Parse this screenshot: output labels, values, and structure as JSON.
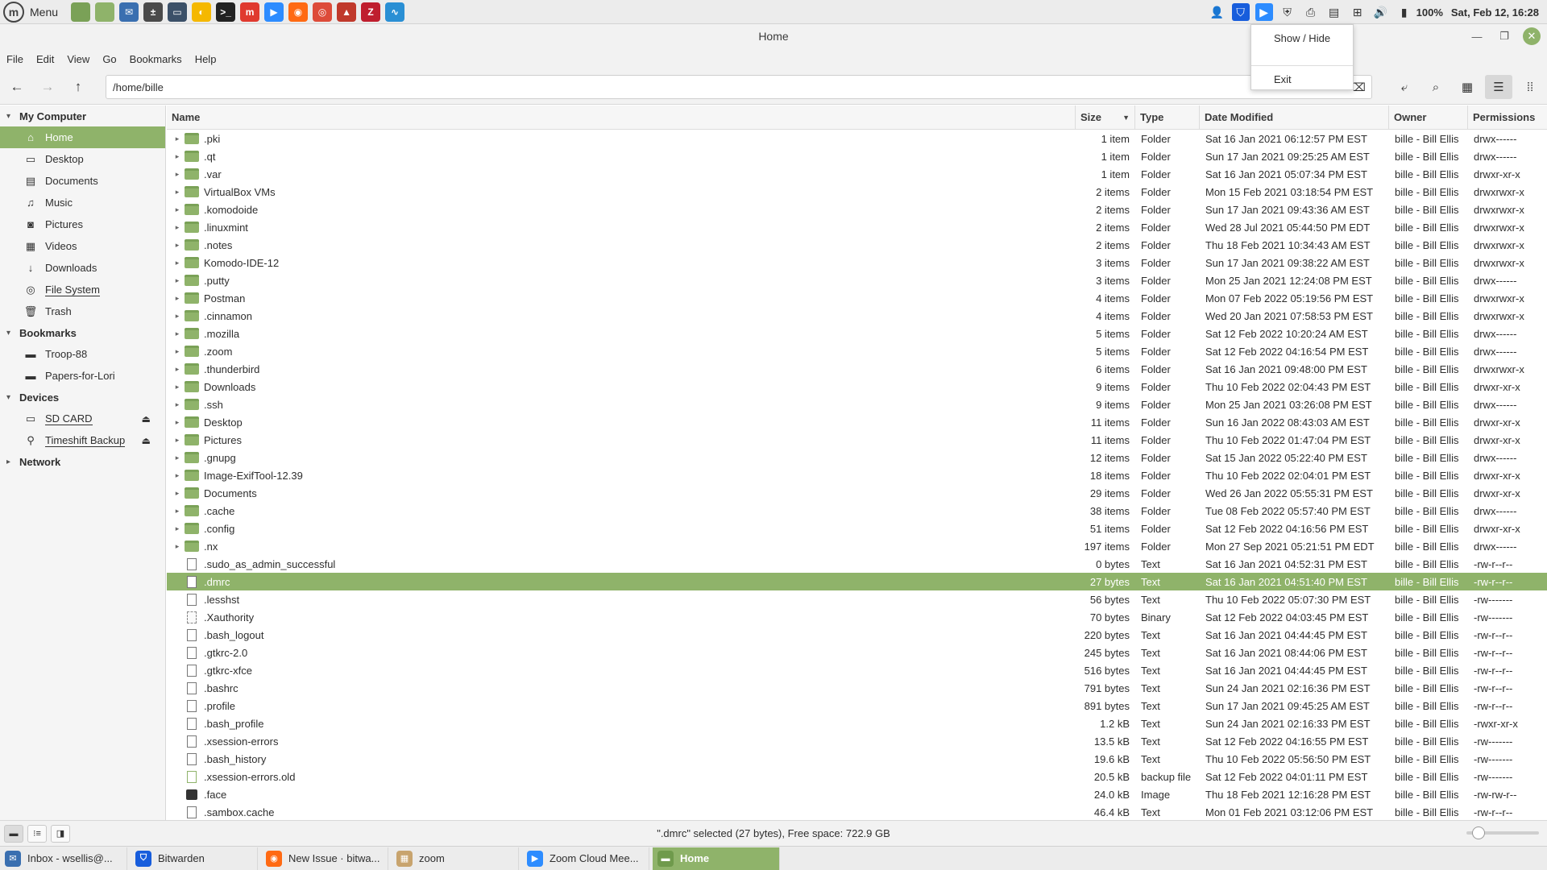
{
  "top_panel": {
    "menu_label": "Menu",
    "battery": "100%",
    "clock": "Sat, Feb 12, 16:28",
    "launchers": [
      {
        "name": "show-desktop-icon",
        "color": "#7aa157",
        "glyph": ""
      },
      {
        "name": "files-icon",
        "color": "#8fb36a",
        "glyph": ""
      },
      {
        "name": "mail-icon",
        "color": "#3a6fb0",
        "glyph": "✉"
      },
      {
        "name": "calculator-icon",
        "color": "#4a4a4a",
        "glyph": "±"
      },
      {
        "name": "virtualbox-icon",
        "color": "#3b5068",
        "glyph": "▭"
      },
      {
        "name": "app-yellow-icon",
        "color": "#f5b800",
        "glyph": "◐"
      },
      {
        "name": "terminal-icon",
        "color": "#222222",
        "glyph": ">_"
      },
      {
        "name": "app-red-icon",
        "color": "#e03a2f",
        "glyph": "m"
      },
      {
        "name": "zoom-icon",
        "color": "#2d8cff",
        "glyph": "▶"
      },
      {
        "name": "firefox-icon",
        "color": "#ff6a13",
        "glyph": "◉"
      },
      {
        "name": "chrome-icon",
        "color": "#dd4b39",
        "glyph": "◎"
      },
      {
        "name": "image-viewer-icon",
        "color": "#c0392b",
        "glyph": "▲"
      },
      {
        "name": "filezilla-icon",
        "color": "#bf1e2e",
        "glyph": "Z"
      },
      {
        "name": "system-monitor-icon",
        "color": "#2a8fd4",
        "glyph": "∿"
      }
    ],
    "tray": [
      {
        "name": "user-icon",
        "glyph": "👤"
      },
      {
        "name": "bitwarden-tray-icon",
        "glyph": "⛉"
      },
      {
        "name": "zoom-tray-icon",
        "glyph": "▶"
      },
      {
        "name": "shield-icon",
        "glyph": "⛨"
      },
      {
        "name": "printer-icon",
        "glyph": "⎙"
      },
      {
        "name": "clipboard-icon",
        "glyph": "▤"
      },
      {
        "name": "network-icon",
        "glyph": "⊞"
      },
      {
        "name": "volume-icon",
        "glyph": "🔊"
      },
      {
        "name": "battery-icon",
        "glyph": "▮"
      }
    ]
  },
  "window": {
    "title": "Home"
  },
  "menubar": [
    "File",
    "Edit",
    "View",
    "Go",
    "Bookmarks",
    "Help"
  ],
  "toolbar": {
    "location": "/home/bille"
  },
  "popup_menu": {
    "show_hide": "Show / Hide",
    "exit": "Exit"
  },
  "sidebar": {
    "sections": [
      {
        "title": "My Computer",
        "expanded": true,
        "items": [
          {
            "label": "Home",
            "icon": "home-icon",
            "glyph": "⌂",
            "selected": true
          },
          {
            "label": "Desktop",
            "icon": "desktop-icon",
            "glyph": "▭"
          },
          {
            "label": "Documents",
            "icon": "documents-icon",
            "glyph": "▤"
          },
          {
            "label": "Music",
            "icon": "music-icon",
            "glyph": "♫"
          },
          {
            "label": "Pictures",
            "icon": "pictures-icon",
            "glyph": "◙"
          },
          {
            "label": "Videos",
            "icon": "videos-icon",
            "glyph": "▦"
          },
          {
            "label": "Downloads",
            "icon": "downloads-icon",
            "glyph": "↓"
          },
          {
            "label": "File System",
            "icon": "filesystem-icon",
            "glyph": "◎",
            "underline": true
          },
          {
            "label": "Trash",
            "icon": "trash-icon",
            "glyph": "🗑"
          }
        ]
      },
      {
        "title": "Bookmarks",
        "expanded": true,
        "items": [
          {
            "label": "Troop-88",
            "icon": "folder-icon",
            "glyph": "▬"
          },
          {
            "label": "Papers-for-Lori",
            "icon": "folder-icon",
            "glyph": "▬"
          }
        ]
      },
      {
        "title": "Devices",
        "expanded": true,
        "items": [
          {
            "label": "SD CARD",
            "icon": "sdcard-icon",
            "glyph": "▭",
            "eject": true,
            "underline": true
          },
          {
            "label": "Timeshift Backup",
            "icon": "usb-icon",
            "glyph": "⚲",
            "eject": true,
            "underline": true
          }
        ]
      },
      {
        "title": "Network",
        "expanded": false,
        "items": []
      }
    ]
  },
  "columns": {
    "name": "Name",
    "size": "Size",
    "type": "Type",
    "date": "Date Modified",
    "owner": "Owner",
    "perm": "Permissions"
  },
  "files": [
    {
      "name": ".pki",
      "size": "1 item",
      "type": "Folder",
      "date": "Sat 16 Jan 2021 06:12:57 PM EST",
      "owner": "bille - Bill Ellis",
      "perm": "drwx------",
      "kind": "folder"
    },
    {
      "name": ".qt",
      "size": "1 item",
      "type": "Folder",
      "date": "Sun 17 Jan 2021 09:25:25 AM EST",
      "owner": "bille - Bill Ellis",
      "perm": "drwx------",
      "kind": "folder"
    },
    {
      "name": ".var",
      "size": "1 item",
      "type": "Folder",
      "date": "Sat 16 Jan 2021 05:07:34 PM EST",
      "owner": "bille - Bill Ellis",
      "perm": "drwxr-xr-x",
      "kind": "folder"
    },
    {
      "name": "VirtualBox VMs",
      "size": "2 items",
      "type": "Folder",
      "date": "Mon 15 Feb 2021 03:18:54 PM EST",
      "owner": "bille - Bill Ellis",
      "perm": "drwxrwxr-x",
      "kind": "folder"
    },
    {
      "name": ".komodoide",
      "size": "2 items",
      "type": "Folder",
      "date": "Sun 17 Jan 2021 09:43:36 AM EST",
      "owner": "bille - Bill Ellis",
      "perm": "drwxrwxr-x",
      "kind": "folder"
    },
    {
      "name": ".linuxmint",
      "size": "2 items",
      "type": "Folder",
      "date": "Wed 28 Jul 2021 05:44:50 PM EDT",
      "owner": "bille - Bill Ellis",
      "perm": "drwxrwxr-x",
      "kind": "folder"
    },
    {
      "name": ".notes",
      "size": "2 items",
      "type": "Folder",
      "date": "Thu 18 Feb 2021 10:34:43 AM EST",
      "owner": "bille - Bill Ellis",
      "perm": "drwxrwxr-x",
      "kind": "folder"
    },
    {
      "name": "Komodo-IDE-12",
      "size": "3 items",
      "type": "Folder",
      "date": "Sun 17 Jan 2021 09:38:22 AM EST",
      "owner": "bille - Bill Ellis",
      "perm": "drwxrwxr-x",
      "kind": "folder"
    },
    {
      "name": ".putty",
      "size": "3 items",
      "type": "Folder",
      "date": "Mon 25 Jan 2021 12:24:08 PM EST",
      "owner": "bille - Bill Ellis",
      "perm": "drwx------",
      "kind": "folder"
    },
    {
      "name": "Postman",
      "size": "4 items",
      "type": "Folder",
      "date": "Mon 07 Feb 2022 05:19:56 PM EST",
      "owner": "bille - Bill Ellis",
      "perm": "drwxrwxr-x",
      "kind": "folder"
    },
    {
      "name": ".cinnamon",
      "size": "4 items",
      "type": "Folder",
      "date": "Wed 20 Jan 2021 07:58:53 PM EST",
      "owner": "bille - Bill Ellis",
      "perm": "drwxrwxr-x",
      "kind": "folder"
    },
    {
      "name": ".mozilla",
      "size": "5 items",
      "type": "Folder",
      "date": "Sat 12 Feb 2022 10:20:24 AM EST",
      "owner": "bille - Bill Ellis",
      "perm": "drwx------",
      "kind": "folder"
    },
    {
      "name": ".zoom",
      "size": "5 items",
      "type": "Folder",
      "date": "Sat 12 Feb 2022 04:16:54 PM EST",
      "owner": "bille - Bill Ellis",
      "perm": "drwx------",
      "kind": "folder"
    },
    {
      "name": ".thunderbird",
      "size": "6 items",
      "type": "Folder",
      "date": "Sat 16 Jan 2021 09:48:00 PM EST",
      "owner": "bille - Bill Ellis",
      "perm": "drwxrwxr-x",
      "kind": "folder"
    },
    {
      "name": "Downloads",
      "size": "9 items",
      "type": "Folder",
      "date": "Thu 10 Feb 2022 02:04:43 PM EST",
      "owner": "bille - Bill Ellis",
      "perm": "drwxr-xr-x",
      "kind": "folder"
    },
    {
      "name": ".ssh",
      "size": "9 items",
      "type": "Folder",
      "date": "Mon 25 Jan 2021 03:26:08 PM EST",
      "owner": "bille - Bill Ellis",
      "perm": "drwx------",
      "kind": "folder"
    },
    {
      "name": "Desktop",
      "size": "11 items",
      "type": "Folder",
      "date": "Sun 16 Jan 2022 08:43:03 AM EST",
      "owner": "bille - Bill Ellis",
      "perm": "drwxr-xr-x",
      "kind": "folder"
    },
    {
      "name": "Pictures",
      "size": "11 items",
      "type": "Folder",
      "date": "Thu 10 Feb 2022 01:47:04 PM EST",
      "owner": "bille - Bill Ellis",
      "perm": "drwxr-xr-x",
      "kind": "folder"
    },
    {
      "name": ".gnupg",
      "size": "12 items",
      "type": "Folder",
      "date": "Sat 15 Jan 2022 05:22:40 PM EST",
      "owner": "bille - Bill Ellis",
      "perm": "drwx------",
      "kind": "folder"
    },
    {
      "name": "Image-ExifTool-12.39",
      "size": "18 items",
      "type": "Folder",
      "date": "Thu 10 Feb 2022 02:04:01 PM EST",
      "owner": "bille - Bill Ellis",
      "perm": "drwxr-xr-x",
      "kind": "folder"
    },
    {
      "name": "Documents",
      "size": "29 items",
      "type": "Folder",
      "date": "Wed 26 Jan 2022 05:55:31 PM EST",
      "owner": "bille - Bill Ellis",
      "perm": "drwxr-xr-x",
      "kind": "folder"
    },
    {
      "name": ".cache",
      "size": "38 items",
      "type": "Folder",
      "date": "Tue 08 Feb 2022 05:57:40 PM EST",
      "owner": "bille - Bill Ellis",
      "perm": "drwx------",
      "kind": "folder"
    },
    {
      "name": ".config",
      "size": "51 items",
      "type": "Folder",
      "date": "Sat 12 Feb 2022 04:16:56 PM EST",
      "owner": "bille - Bill Ellis",
      "perm": "drwxr-xr-x",
      "kind": "folder"
    },
    {
      "name": ".nx",
      "size": "197 items",
      "type": "Folder",
      "date": "Mon 27 Sep 2021 05:21:51 PM EDT",
      "owner": "bille - Bill Ellis",
      "perm": "drwx------",
      "kind": "folder"
    },
    {
      "name": ".sudo_as_admin_successful",
      "size": "0 bytes",
      "type": "Text",
      "date": "Sat 16 Jan 2021 04:52:31 PM EST",
      "owner": "bille - Bill Ellis",
      "perm": "-rw-r--r--",
      "kind": "doc"
    },
    {
      "name": ".dmrc",
      "size": "27 bytes",
      "type": "Text",
      "date": "Sat 16 Jan 2021 04:51:40 PM EST",
      "owner": "bille - Bill Ellis",
      "perm": "-rw-r--r--",
      "kind": "doc",
      "selected": true
    },
    {
      "name": ".lesshst",
      "size": "56 bytes",
      "type": "Text",
      "date": "Thu 10 Feb 2022 05:07:30 PM EST",
      "owner": "bille - Bill Ellis",
      "perm": "-rw-------",
      "kind": "doc"
    },
    {
      "name": ".Xauthority",
      "size": "70 bytes",
      "type": "Binary",
      "date": "Sat 12 Feb 2022 04:03:45 PM EST",
      "owner": "bille - Bill Ellis",
      "perm": "-rw-------",
      "kind": "bin"
    },
    {
      "name": ".bash_logout",
      "size": "220 bytes",
      "type": "Text",
      "date": "Sat 16 Jan 2021 04:44:45 PM EST",
      "owner": "bille - Bill Ellis",
      "perm": "-rw-r--r--",
      "kind": "doc"
    },
    {
      "name": ".gtkrc-2.0",
      "size": "245 bytes",
      "type": "Text",
      "date": "Sat 16 Jan 2021 08:44:06 PM EST",
      "owner": "bille - Bill Ellis",
      "perm": "-rw-r--r--",
      "kind": "doc"
    },
    {
      "name": ".gtkrc-xfce",
      "size": "516 bytes",
      "type": "Text",
      "date": "Sat 16 Jan 2021 04:44:45 PM EST",
      "owner": "bille - Bill Ellis",
      "perm": "-rw-r--r--",
      "kind": "doc"
    },
    {
      "name": ".bashrc",
      "size": "791 bytes",
      "type": "Text",
      "date": "Sun 24 Jan 2021 02:16:36 PM EST",
      "owner": "bille - Bill Ellis",
      "perm": "-rw-r--r--",
      "kind": "doc"
    },
    {
      "name": ".profile",
      "size": "891 bytes",
      "type": "Text",
      "date": "Sun 17 Jan 2021 09:45:25 AM EST",
      "owner": "bille - Bill Ellis",
      "perm": "-rw-r--r--",
      "kind": "doc"
    },
    {
      "name": ".bash_profile",
      "size": "1.2 kB",
      "type": "Text",
      "date": "Sun 24 Jan 2021 02:16:33 PM EST",
      "owner": "bille - Bill Ellis",
      "perm": "-rwxr-xr-x",
      "kind": "doc"
    },
    {
      "name": ".xsession-errors",
      "size": "13.5 kB",
      "type": "Text",
      "date": "Sat 12 Feb 2022 04:16:55 PM EST",
      "owner": "bille - Bill Ellis",
      "perm": "-rw-------",
      "kind": "doc"
    },
    {
      "name": ".bash_history",
      "size": "19.6 kB",
      "type": "Text",
      "date": "Thu 10 Feb 2022 05:56:50 PM EST",
      "owner": "bille - Bill Ellis",
      "perm": "-rw-------",
      "kind": "doc"
    },
    {
      "name": ".xsession-errors.old",
      "size": "20.5 kB",
      "type": "backup file",
      "date": "Sat 12 Feb 2022 04:01:11 PM EST",
      "owner": "bille - Bill Ellis",
      "perm": "-rw-------",
      "kind": "bak"
    },
    {
      "name": ".face",
      "size": "24.0 kB",
      "type": "Image",
      "date": "Thu 18 Feb 2021 12:16:28 PM EST",
      "owner": "bille - Bill Ellis",
      "perm": "-rw-rw-r--",
      "kind": "img"
    },
    {
      "name": ".sambox.cache",
      "size": "46.4 kB",
      "type": "Text",
      "date": "Mon 01 Feb 2021 03:12:06 PM EST",
      "owner": "bille - Bill Ellis",
      "perm": "-rw-r--r--",
      "kind": "doc"
    }
  ],
  "statusbar": {
    "text": "\".dmrc\" selected (27 bytes), Free space: 722.9 GB",
    "zoom_level": 0.1
  },
  "taskbar": [
    {
      "label": "Inbox - wsellis@...",
      "icon": "mail-icon",
      "color": "#3a6fb0",
      "glyph": "✉"
    },
    {
      "label": "Bitwarden",
      "icon": "bitwarden-icon",
      "color": "#175ddc",
      "glyph": "⛉"
    },
    {
      "label": "New Issue · bitwa...",
      "icon": "firefox-icon",
      "color": "#ff6a13",
      "glyph": "◉"
    },
    {
      "label": "zoom",
      "icon": "package-icon",
      "color": "#c8a46e",
      "glyph": "▦"
    },
    {
      "label": "Zoom Cloud Mee...",
      "icon": "zoom-icon",
      "color": "#2d8cff",
      "glyph": "▶"
    },
    {
      "label": "Home",
      "icon": "folder-icon",
      "color": "#6f9a4c",
      "glyph": "▬",
      "active": true
    }
  ]
}
